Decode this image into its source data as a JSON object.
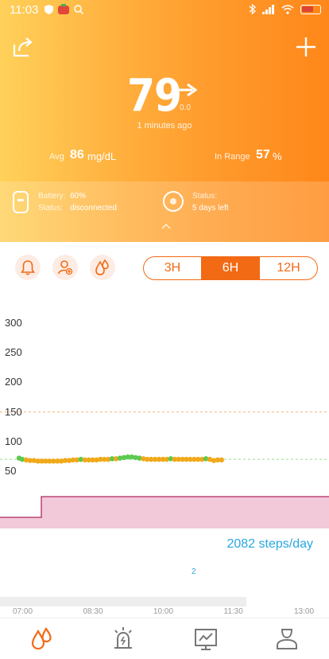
{
  "status_bar": {
    "time": "11:03"
  },
  "reading": {
    "value": "79",
    "delta": "0.0",
    "updated": "1 minutes ago"
  },
  "stats": {
    "avg_label": "Avg",
    "avg_value": "86",
    "avg_unit": "mg/dL",
    "range_label": "In Range",
    "range_value": "57",
    "range_unit": "%"
  },
  "device": {
    "battery_label": "Battery:",
    "battery_value": "60%",
    "status_label": "Status:",
    "status_value": "disconnected",
    "sensor_status_label": "Status:",
    "sensor_status_value": "5 days left"
  },
  "toolbar": {
    "ranges": [
      {
        "label": "3H",
        "active": false
      },
      {
        "label": "6H",
        "active": true
      },
      {
        "label": "12H",
        "active": false
      }
    ]
  },
  "chart_data": {
    "type": "scatter",
    "y_ticks": [
      "300",
      "250",
      "200",
      "150",
      "100",
      "50"
    ],
    "ylim": [
      0,
      300
    ],
    "target_high": 150,
    "target_low": 70,
    "x_ticks": [
      "07:00",
      "08:30",
      "10:00",
      "11:30",
      "13:00"
    ],
    "colors": {
      "in_range": "#5cc94f",
      "low": "#f0a91a",
      "limit_high": "#f5b878",
      "limit_low": "#9bdc8d",
      "insulin": "#f1c9d9",
      "insulin_line": "#b0285f"
    },
    "points": [
      {
        "x": "06:54",
        "y": 72,
        "zone": "in_range"
      },
      {
        "x": "06:58",
        "y": 70,
        "zone": "in_range"
      },
      {
        "x": "07:03",
        "y": 69,
        "zone": "low"
      },
      {
        "x": "07:08",
        "y": 68,
        "zone": "low"
      },
      {
        "x": "07:13",
        "y": 68,
        "zone": "low"
      },
      {
        "x": "07:18",
        "y": 67,
        "zone": "low"
      },
      {
        "x": "07:23",
        "y": 67,
        "zone": "low"
      },
      {
        "x": "07:28",
        "y": 67,
        "zone": "low"
      },
      {
        "x": "07:33",
        "y": 67,
        "zone": "low"
      },
      {
        "x": "07:38",
        "y": 67,
        "zone": "low"
      },
      {
        "x": "07:43",
        "y": 67,
        "zone": "low"
      },
      {
        "x": "07:48",
        "y": 67,
        "zone": "low"
      },
      {
        "x": "07:53",
        "y": 68,
        "zone": "low"
      },
      {
        "x": "07:58",
        "y": 68,
        "zone": "low"
      },
      {
        "x": "08:03",
        "y": 69,
        "zone": "low"
      },
      {
        "x": "08:08",
        "y": 69,
        "zone": "low"
      },
      {
        "x": "08:13",
        "y": 70,
        "zone": "in_range"
      },
      {
        "x": "08:18",
        "y": 69,
        "zone": "low"
      },
      {
        "x": "08:23",
        "y": 69,
        "zone": "low"
      },
      {
        "x": "08:28",
        "y": 69,
        "zone": "low"
      },
      {
        "x": "08:33",
        "y": 69,
        "zone": "low"
      },
      {
        "x": "08:38",
        "y": 70,
        "zone": "low"
      },
      {
        "x": "08:43",
        "y": 70,
        "zone": "low"
      },
      {
        "x": "08:48",
        "y": 70,
        "zone": "low"
      },
      {
        "x": "08:53",
        "y": 71,
        "zone": "in_range"
      },
      {
        "x": "08:58",
        "y": 71,
        "zone": "low"
      },
      {
        "x": "09:03",
        "y": 72,
        "zone": "in_range"
      },
      {
        "x": "09:08",
        "y": 73,
        "zone": "in_range"
      },
      {
        "x": "09:13",
        "y": 74,
        "zone": "in_range"
      },
      {
        "x": "09:18",
        "y": 74,
        "zone": "in_range"
      },
      {
        "x": "09:23",
        "y": 73,
        "zone": "in_range"
      },
      {
        "x": "09:28",
        "y": 72,
        "zone": "in_range"
      },
      {
        "x": "09:33",
        "y": 71,
        "zone": "low"
      },
      {
        "x": "09:38",
        "y": 70,
        "zone": "low"
      },
      {
        "x": "09:43",
        "y": 70,
        "zone": "low"
      },
      {
        "x": "09:48",
        "y": 70,
        "zone": "low"
      },
      {
        "x": "09:53",
        "y": 70,
        "zone": "low"
      },
      {
        "x": "09:58",
        "y": 70,
        "zone": "low"
      },
      {
        "x": "10:03",
        "y": 70,
        "zone": "low"
      },
      {
        "x": "10:08",
        "y": 71,
        "zone": "in_range"
      },
      {
        "x": "10:13",
        "y": 70,
        "zone": "low"
      },
      {
        "x": "10:18",
        "y": 70,
        "zone": "low"
      },
      {
        "x": "10:23",
        "y": 70,
        "zone": "low"
      },
      {
        "x": "10:28",
        "y": 70,
        "zone": "low"
      },
      {
        "x": "10:33",
        "y": 70,
        "zone": "low"
      },
      {
        "x": "10:38",
        "y": 70,
        "zone": "low"
      },
      {
        "x": "10:43",
        "y": 70,
        "zone": "low"
      },
      {
        "x": "10:48",
        "y": 70,
        "zone": "low"
      },
      {
        "x": "10:53",
        "y": 71,
        "zone": "in_range"
      },
      {
        "x": "10:58",
        "y": 70,
        "zone": "low"
      },
      {
        "x": "11:03",
        "y": 68,
        "zone": "low"
      },
      {
        "x": "11:08",
        "y": 69,
        "zone": "low"
      },
      {
        "x": "11:13",
        "y": 69,
        "zone": "low"
      }
    ]
  },
  "activity": {
    "steps_summary": "2082 steps/day",
    "steps_count": "2"
  }
}
